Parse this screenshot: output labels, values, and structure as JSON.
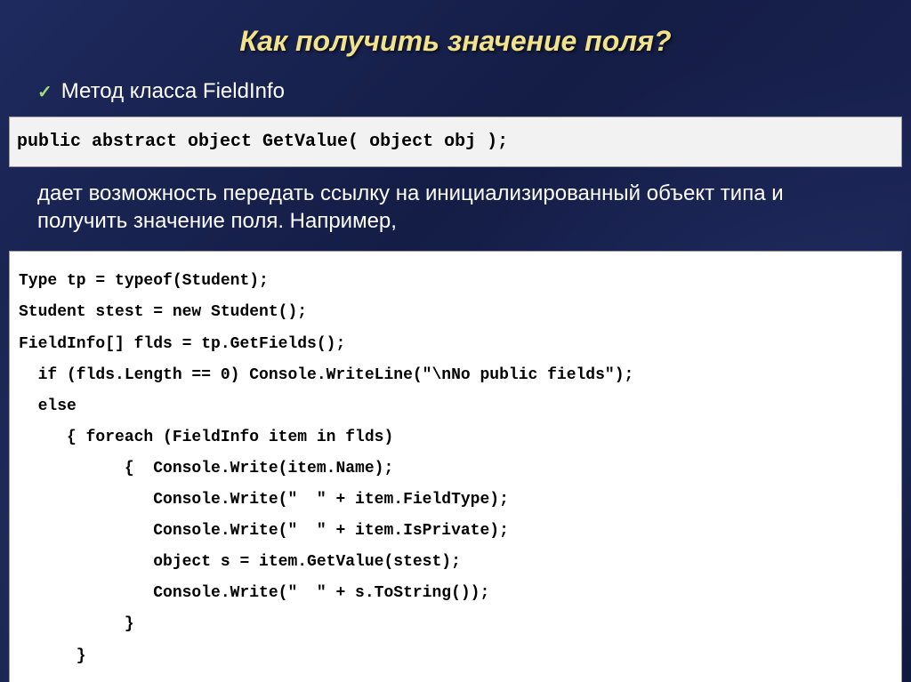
{
  "slide": {
    "title": "Как получить значение поля?",
    "bullet1": "Метод класса FieldInfo",
    "signature": "public abstract object GetValue( object obj );",
    "description": "дает возможность передать ссылку на инициализированный объект типа и получить значение поля. Например,",
    "code": "Type tp = typeof(Student);\nStudent stest = new Student();\nFieldInfo[] flds = tp.GetFields();\n  if (flds.Length == 0) Console.WriteLine(\"\\nNo public fields\");\n  else\n     { foreach (FieldInfo item in flds)\n           {  Console.Write(item.Name);\n              Console.Write(\"  \" + item.FieldType);\n              Console.Write(\"  \" + item.IsPrivate);\n              object s = item.GetValue(stest);\n              Console.Write(\"  \" + s.ToString());\n           }\n      }"
  }
}
